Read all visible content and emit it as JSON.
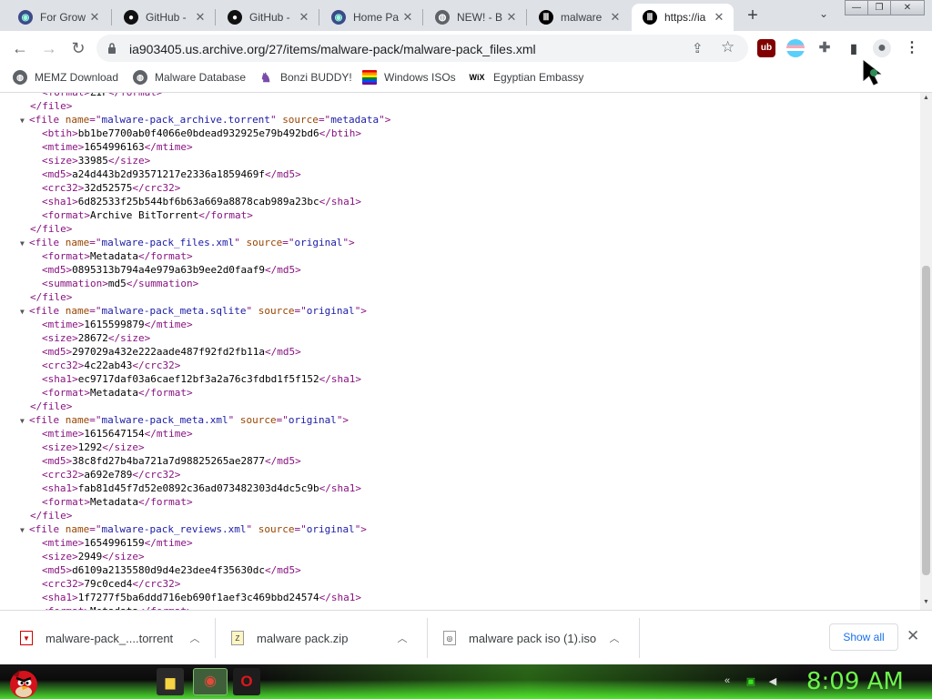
{
  "window_buttons": {
    "minimize": "—",
    "restore": "❐",
    "close": "✕"
  },
  "tabs": [
    {
      "title": "For Grow",
      "icon": "globe-icon",
      "glyph": "◉"
    },
    {
      "title": "GitHub -",
      "icon": "github-icon",
      "glyph": "●"
    },
    {
      "title": "GitHub -",
      "icon": "github-icon",
      "glyph": "●"
    },
    {
      "title": "Home Pa",
      "icon": "globe-icon",
      "glyph": "◉"
    },
    {
      "title": "NEW! - B",
      "icon": "world-icon",
      "glyph": "◍"
    },
    {
      "title": "malware",
      "icon": "archive-icon",
      "glyph": "Ⅲ"
    },
    {
      "title": "https://ia",
      "icon": "archive-icon",
      "glyph": "Ⅲ",
      "active": true
    }
  ],
  "tab_close_glyph": "✕",
  "new_tab_glyph": "+",
  "tab_search_glyph": "⌄",
  "toolbar": {
    "back": "←",
    "forward": "→",
    "reload": "↻",
    "url": "ia903405.us.archive.org/27/items/malware-pack/malware-pack_files.xml",
    "share": "⇪",
    "star": "☆",
    "extensions": [
      {
        "icon": "ublock-icon",
        "glyph": "ub",
        "color": "#800000"
      },
      {
        "icon": "flag-extension-icon",
        "glyph": "",
        "color": "#5bcefa"
      },
      {
        "icon": "puzzle-extensions-icon",
        "glyph": "✚",
        "color": "#5f6368"
      },
      {
        "icon": "side-panel-icon",
        "glyph": "▮",
        "color": "#3c4043"
      },
      {
        "icon": "profile-avatar-icon",
        "glyph": "●",
        "color": "#5f6368"
      },
      {
        "icon": "menu-kebab-icon",
        "glyph": "⋮",
        "color": "#3c4043"
      }
    ]
  },
  "bookmarks": [
    {
      "label": "MEMZ Download",
      "icon": "globe-icon",
      "glyph": "◍"
    },
    {
      "label": "Malware Database",
      "icon": "globe-icon",
      "glyph": "◍"
    },
    {
      "label": "Bonzi BUDDY!",
      "icon": "bonzi-icon",
      "glyph": "♞"
    },
    {
      "label": "Windows ISOs",
      "icon": "rainbow-flag-icon",
      "glyph": ""
    },
    {
      "label": "Egyptian Embassy",
      "icon": "wix-icon",
      "glyph": "WiX"
    }
  ],
  "xml_lines": [
    {
      "t": "plain",
      "indent": 1,
      "open": "format",
      "text": "ZIP",
      "close": "format"
    },
    {
      "t": "close",
      "indent": 0,
      "tag": "file"
    },
    {
      "t": "fileopen",
      "name": "malware-pack_archive.torrent",
      "source": "metadata"
    },
    {
      "t": "plain",
      "indent": 1,
      "open": "btih",
      "text": "bb1be7700ab0f4066e0bdead932925e79b492bd6",
      "close": "btih"
    },
    {
      "t": "plain",
      "indent": 1,
      "open": "mtime",
      "text": "1654996163",
      "close": "mtime"
    },
    {
      "t": "plain",
      "indent": 1,
      "open": "size",
      "text": "33985",
      "close": "size"
    },
    {
      "t": "plain",
      "indent": 1,
      "open": "md5",
      "text": "a24d443b2d93571217e2336a1859469f",
      "close": "md5"
    },
    {
      "t": "plain",
      "indent": 1,
      "open": "crc32",
      "text": "32d52575",
      "close": "crc32"
    },
    {
      "t": "plain",
      "indent": 1,
      "open": "sha1",
      "text": "6d82533f25b544bf6b63a669a8878cab989a23bc",
      "close": "sha1"
    },
    {
      "t": "plain",
      "indent": 1,
      "open": "format",
      "text": "Archive BitTorrent",
      "close": "format"
    },
    {
      "t": "close",
      "indent": 0,
      "tag": "file"
    },
    {
      "t": "fileopen",
      "name": "malware-pack_files.xml",
      "source": "original"
    },
    {
      "t": "plain",
      "indent": 1,
      "open": "format",
      "text": "Metadata",
      "close": "format"
    },
    {
      "t": "plain",
      "indent": 1,
      "open": "md5",
      "text": "0895313b794a4e979a63b9ee2d0faaf9",
      "close": "md5"
    },
    {
      "t": "plain",
      "indent": 1,
      "open": "summation",
      "text": "md5",
      "close": "summation"
    },
    {
      "t": "close",
      "indent": 0,
      "tag": "file"
    },
    {
      "t": "fileopen",
      "name": "malware-pack_meta.sqlite",
      "source": "original"
    },
    {
      "t": "plain",
      "indent": 1,
      "open": "mtime",
      "text": "1615599879",
      "close": "mtime"
    },
    {
      "t": "plain",
      "indent": 1,
      "open": "size",
      "text": "28672",
      "close": "size"
    },
    {
      "t": "plain",
      "indent": 1,
      "open": "md5",
      "text": "297029a432e222aade487f92fd2fb11a",
      "close": "md5"
    },
    {
      "t": "plain",
      "indent": 1,
      "open": "crc32",
      "text": "4c22ab43",
      "close": "crc32"
    },
    {
      "t": "plain",
      "indent": 1,
      "open": "sha1",
      "text": "ec9717daf03a6caef12bf3a2a76c3fdbd1f5f152",
      "close": "sha1"
    },
    {
      "t": "plain",
      "indent": 1,
      "open": "format",
      "text": "Metadata",
      "close": "format"
    },
    {
      "t": "close",
      "indent": 0,
      "tag": "file"
    },
    {
      "t": "fileopen",
      "name": "malware-pack_meta.xml",
      "source": "original"
    },
    {
      "t": "plain",
      "indent": 1,
      "open": "mtime",
      "text": "1615647154",
      "close": "mtime"
    },
    {
      "t": "plain",
      "indent": 1,
      "open": "size",
      "text": "1292",
      "close": "size"
    },
    {
      "t": "plain",
      "indent": 1,
      "open": "md5",
      "text": "38c8fd27b4ba721a7d98825265ae2877",
      "close": "md5"
    },
    {
      "t": "plain",
      "indent": 1,
      "open": "crc32",
      "text": "a692e789",
      "close": "crc32"
    },
    {
      "t": "plain",
      "indent": 1,
      "open": "sha1",
      "text": "fab81d45f7d52e0892c36ad073482303d4dc5c9b",
      "close": "sha1"
    },
    {
      "t": "plain",
      "indent": 1,
      "open": "format",
      "text": "Metadata",
      "close": "format"
    },
    {
      "t": "close",
      "indent": 0,
      "tag": "file"
    },
    {
      "t": "fileopen",
      "name": "malware-pack_reviews.xml",
      "source": "original"
    },
    {
      "t": "plain",
      "indent": 1,
      "open": "mtime",
      "text": "1654996159",
      "close": "mtime"
    },
    {
      "t": "plain",
      "indent": 1,
      "open": "size",
      "text": "2949",
      "close": "size"
    },
    {
      "t": "plain",
      "indent": 1,
      "open": "md5",
      "text": "d6109a2135580d9d4e23dee4f35630dc",
      "close": "md5"
    },
    {
      "t": "plain",
      "indent": 1,
      "open": "crc32",
      "text": "79c0ced4",
      "close": "crc32"
    },
    {
      "t": "plain",
      "indent": 1,
      "open": "sha1",
      "text": "1f7277f5ba6ddd716eb690f1aef3c469bbd24574",
      "close": "sha1"
    },
    {
      "t": "plain",
      "indent": 1,
      "open": "format",
      "text": "Metadata",
      "close": "format"
    }
  ],
  "scroll_arrows": {
    "up": "▲",
    "down": "▼"
  },
  "downloads": [
    {
      "name": "malware-pack_....torrent",
      "icon": "torrent-file-icon",
      "glyph": "▼"
    },
    {
      "name": "malware pack.zip",
      "icon": "zip-archive-icon",
      "glyph": "Z"
    },
    {
      "name": "malware pack iso (1).iso",
      "icon": "iso-disc-icon",
      "glyph": "◎"
    }
  ],
  "download_chevron": "︿",
  "show_all_label": "Show all",
  "downloads_close": "✕",
  "taskbar": {
    "clock": "8:09 AM",
    "tasks": [
      {
        "icon": "file-explorer-icon",
        "glyph": "▆"
      },
      {
        "icon": "chrome-icon",
        "glyph": "◉"
      },
      {
        "icon": "opera-icon",
        "glyph": "O"
      }
    ],
    "tray": [
      {
        "icon": "tray-arrow-icon",
        "glyph": "«"
      },
      {
        "icon": "tray-battery-icon",
        "glyph": "▣"
      },
      {
        "icon": "tray-volume-icon",
        "glyph": "◀"
      }
    ]
  }
}
